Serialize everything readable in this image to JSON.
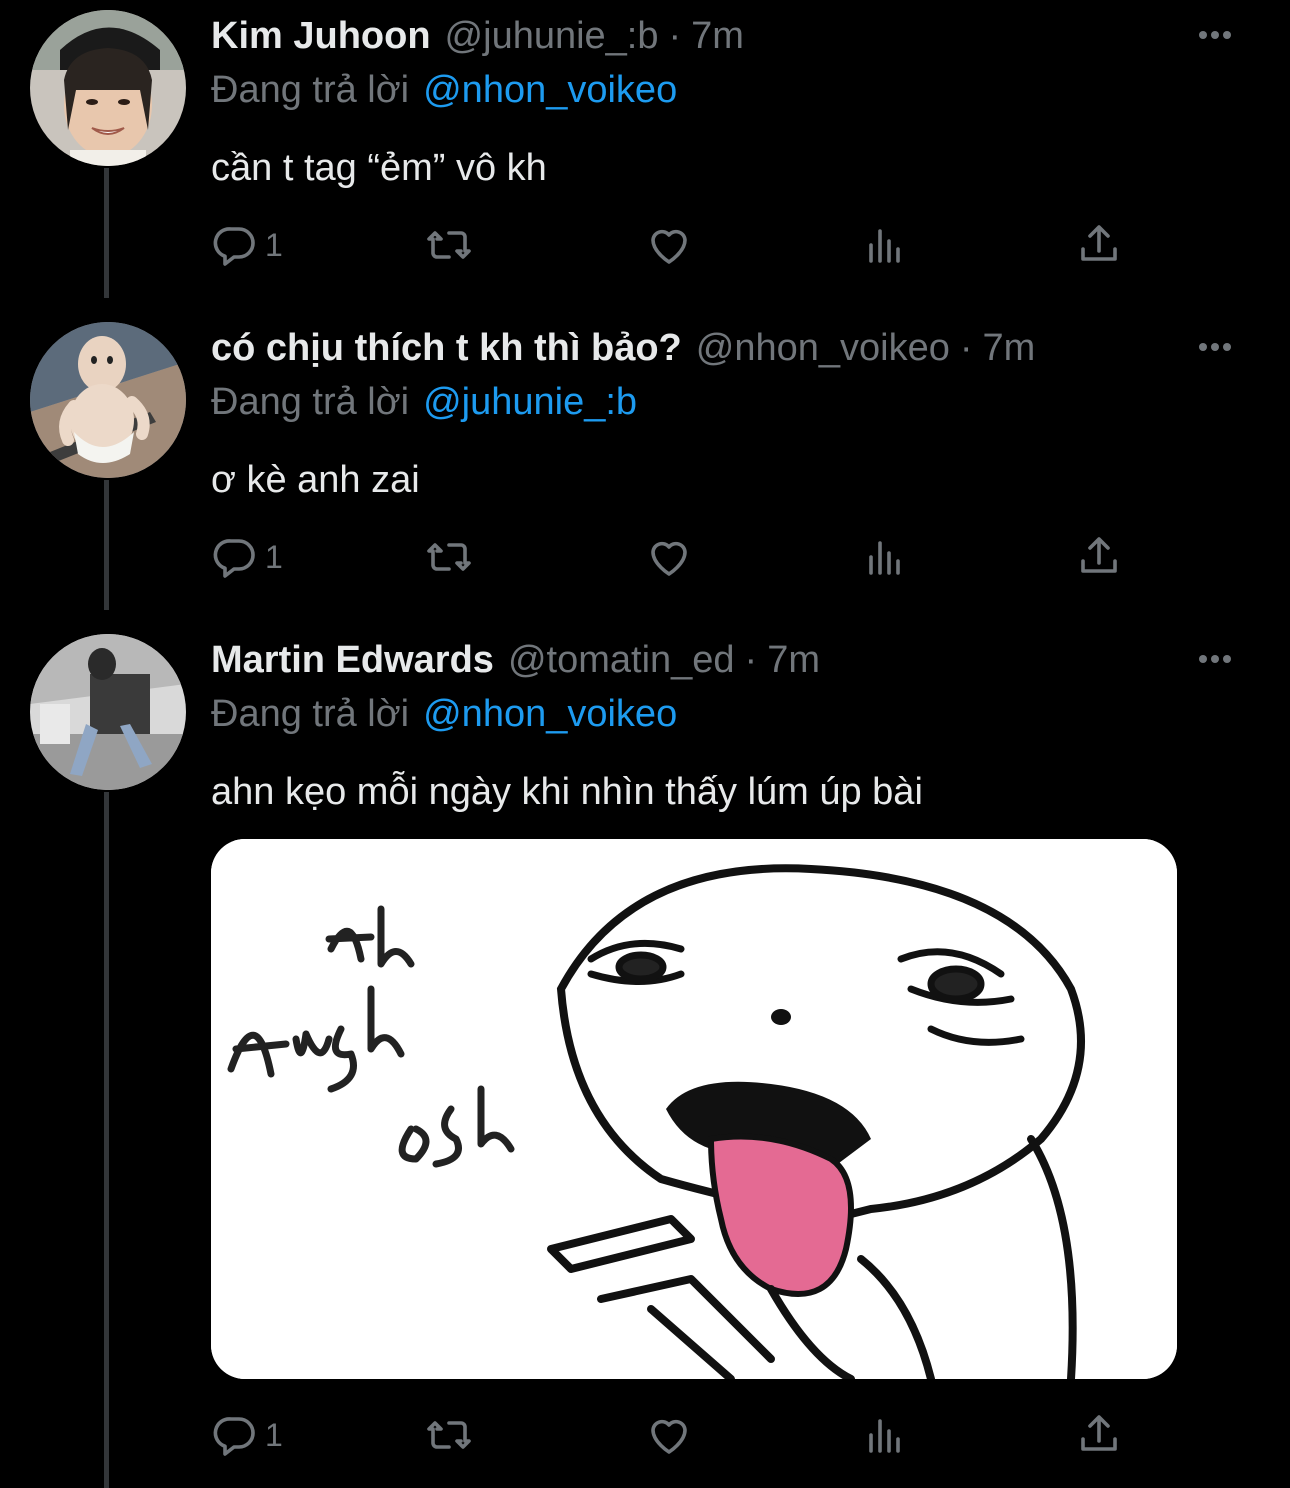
{
  "tweets": [
    {
      "name": "Kim Juhoon",
      "handle": "@juhunie_:b",
      "sep": "·",
      "time": "7m",
      "reply_prefix": "Đang trả lời",
      "reply_handle": "@nhon_voikeo",
      "text": "cần t tag “ẻm” vô kh",
      "reply_count": "1",
      "has_media": false
    },
    {
      "name": "có chịu thích t kh thì bảo?",
      "handle": "@nhon_voikeo",
      "sep": "·",
      "time": "7m",
      "reply_prefix": "Đang trả lời",
      "reply_handle": "@juhunie_:b",
      "text": "ơ kè anh zai",
      "reply_count": "1",
      "has_media": false
    },
    {
      "name": "Martin Edwards",
      "handle": "@tomatin_ed",
      "sep": "·",
      "time": "7m",
      "reply_prefix": "Đang trả lời",
      "reply_handle": "@nhon_voikeo",
      "text": "ahn kẹo mỗi ngày khi nhìn thấy lúm úp bài",
      "reply_count": "1",
      "has_media": true,
      "media": {
        "kind": "meme-drawing",
        "handwritten_text": "Ah Anh ơi"
      }
    }
  ],
  "colors": {
    "background": "#000000",
    "primary_text": "#e7e9ea",
    "secondary_text": "#71767b",
    "link": "#1d9bf0",
    "thread_line": "#333639"
  },
  "icons": {
    "reply": "reply-icon",
    "retweet": "retweet-icon",
    "like": "heart-icon",
    "views": "views-icon",
    "share": "share-icon",
    "more": "more-icon"
  }
}
